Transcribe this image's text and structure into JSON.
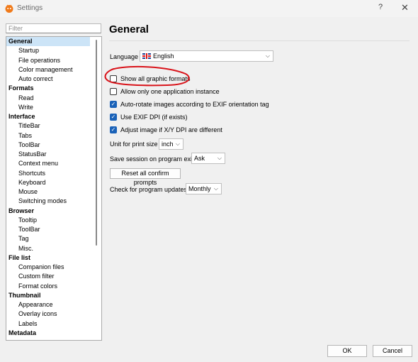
{
  "window": {
    "title": "Settings",
    "help_label": "?",
    "close_label": "✕"
  },
  "sidebar": {
    "filter_placeholder": "Filter",
    "items": [
      {
        "label": "General",
        "level": 0,
        "selected": true
      },
      {
        "label": "Startup",
        "level": 1
      },
      {
        "label": "File operations",
        "level": 1
      },
      {
        "label": "Color management",
        "level": 1
      },
      {
        "label": "Auto correct",
        "level": 1
      },
      {
        "label": "Formats",
        "level": 0
      },
      {
        "label": "Read",
        "level": 1
      },
      {
        "label": "Write",
        "level": 1
      },
      {
        "label": "Interface",
        "level": 0
      },
      {
        "label": "TitleBar",
        "level": 1
      },
      {
        "label": "Tabs",
        "level": 1
      },
      {
        "label": "ToolBar",
        "level": 1
      },
      {
        "label": "StatusBar",
        "level": 1
      },
      {
        "label": "Context menu",
        "level": 1
      },
      {
        "label": "Shortcuts",
        "level": 1
      },
      {
        "label": "Keyboard",
        "level": 1
      },
      {
        "label": "Mouse",
        "level": 1
      },
      {
        "label": "Switching modes",
        "level": 1
      },
      {
        "label": "Browser",
        "level": 0
      },
      {
        "label": "Tooltip",
        "level": 1
      },
      {
        "label": "ToolBar",
        "level": 1
      },
      {
        "label": "Tag",
        "level": 1
      },
      {
        "label": "Misc.",
        "level": 1
      },
      {
        "label": "File list",
        "level": 0
      },
      {
        "label": "Companion files",
        "level": 1
      },
      {
        "label": "Custom filter",
        "level": 1
      },
      {
        "label": "Format colors",
        "level": 1
      },
      {
        "label": "Thumbnail",
        "level": 0
      },
      {
        "label": "Appearance",
        "level": 1
      },
      {
        "label": "Overlay icons",
        "level": 1
      },
      {
        "label": "Labels",
        "level": 1
      },
      {
        "label": "Metadata",
        "level": 0
      }
    ]
  },
  "main": {
    "title": "General",
    "language_label": "Language",
    "language_value": "English",
    "checkboxes": [
      {
        "label": "Show all graphic formats",
        "checked": false
      },
      {
        "label": "Allow only one application instance",
        "checked": false
      },
      {
        "label": "Auto-rotate images according to EXIF orientation tag",
        "checked": true
      },
      {
        "label": "Use EXIF DPI (if exists)",
        "checked": true
      },
      {
        "label": "Adjust image if X/Y DPI are different",
        "checked": true
      }
    ],
    "unit_label": "Unit for print size",
    "unit_value": "inch",
    "session_label": "Save session on program exit",
    "session_value": "Ask",
    "reset_label": "Reset all confirm prompts",
    "updates_label": "Check for program updates",
    "updates_value": "Monthly"
  },
  "footer": {
    "ok_label": "OK",
    "cancel_label": "Cancel"
  },
  "colors": {
    "annotation": "#d9141b",
    "checkbox_checked": "#1a62b8",
    "selected_item": "#cce4f7"
  }
}
